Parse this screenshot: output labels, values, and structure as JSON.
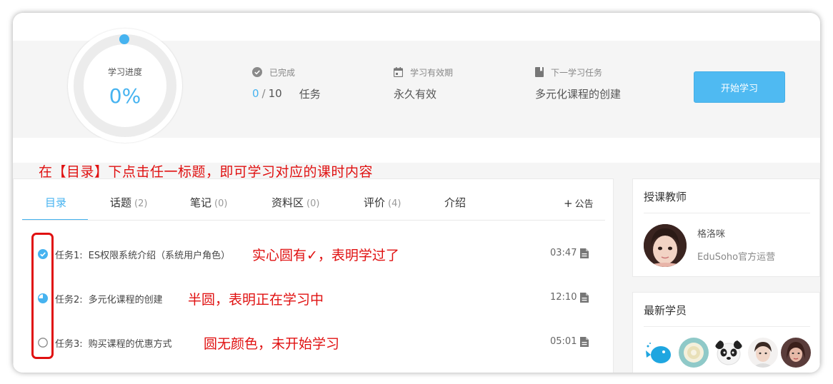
{
  "progress": {
    "label": "学习进度",
    "value": "0%"
  },
  "stats": {
    "completed": {
      "label": "已完成",
      "done": "0",
      "sep": "/",
      "total": "10",
      "unit": "任务"
    },
    "validity": {
      "label": "学习有效期",
      "value": "永久有效"
    },
    "next_task": {
      "label": "下一学习任务",
      "value": "多元化课程的创建"
    }
  },
  "start_button": "开始学习",
  "annotation_top": "在【目录】下点击任一标题，即可学习对应的课时内容",
  "tabs": [
    {
      "label": "目录",
      "count": ""
    },
    {
      "label": "话题",
      "count": "(2)"
    },
    {
      "label": "笔记",
      "count": "(0)"
    },
    {
      "label": "资料区",
      "count": "(0)"
    },
    {
      "label": "评价",
      "count": "(4)"
    },
    {
      "label": "介绍",
      "count": ""
    }
  ],
  "notice_button": {
    "icon": "+",
    "label": "公告"
  },
  "tasks": [
    {
      "index": "任务1:",
      "name": "ES权限系统介绍（系统用户角色）",
      "duration": "03:47",
      "status": "completed",
      "note": "实心圆有✓，表明学过了"
    },
    {
      "index": "任务2:",
      "name": "多元化课程的创建",
      "duration": "12:10",
      "status": "in-progress",
      "note": "半圆，表明正在学习中"
    },
    {
      "index": "任务3:",
      "name": "购买课程的优惠方式",
      "duration": "05:01",
      "status": "not-started",
      "note": "圆无颜色，未开始学习"
    }
  ],
  "teacher_panel": {
    "title": "授课教师",
    "name": "格洛咪",
    "org": "EduSoho官方运营"
  },
  "students_panel": {
    "title": "最新学员"
  },
  "colors": {
    "accent": "#46b3f0",
    "annotation": "#e01010",
    "button": "#4fbaf2"
  }
}
